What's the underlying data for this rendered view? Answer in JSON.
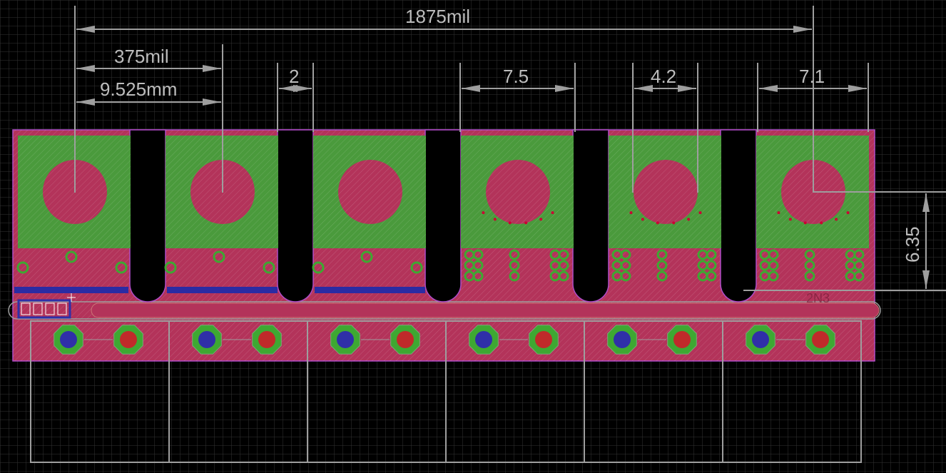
{
  "editor": {
    "view": "pcb-layout",
    "background": "#000000",
    "grid_color": "#3a3a3a"
  },
  "colors": {
    "board_top_copper": "#b3335a",
    "pad_green": "#4a9a3c",
    "hole_magenta": "#b3335a",
    "via_ring_green": "#3ea832",
    "via_blue": "#2f2fa8",
    "trace_blue": "#2b2ba3",
    "dimension_grey": "#9e9e9e",
    "outline_violet": "#b04cc8"
  },
  "dimensions": {
    "total": "1875mil",
    "pitch_mil": "375mil",
    "pitch_mm": "9.525mm",
    "slot_gap": "2",
    "pad_width_a": "7.5",
    "pad_width_b": "4.2",
    "pad_width_c": "7.1",
    "vertical": "6.35"
  },
  "modules": [
    {
      "id": "M1",
      "has_via_cluster": false
    },
    {
      "id": "M2",
      "has_via_cluster": false
    },
    {
      "id": "M3",
      "has_via_cluster": false
    },
    {
      "id": "M4",
      "has_via_cluster": true
    },
    {
      "id": "M5",
      "has_via_cluster": true
    },
    {
      "id": "M6",
      "has_via_cluster": true
    }
  ],
  "silkscreen_label": "2N3"
}
